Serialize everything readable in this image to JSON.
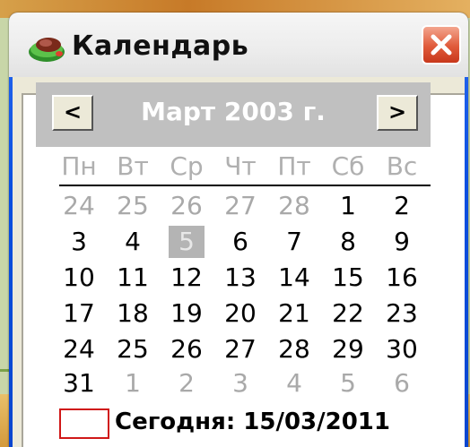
{
  "window": {
    "title": "Календарь"
  },
  "calendar": {
    "month_label": "Март 2003 г.",
    "prev_label": "<",
    "next_label": ">",
    "weekdays": [
      "Пн",
      "Вт",
      "Ср",
      "Чт",
      "Пт",
      "Сб",
      "Вс"
    ],
    "weeks": [
      [
        {
          "d": "24",
          "other": true
        },
        {
          "d": "25",
          "other": true
        },
        {
          "d": "26",
          "other": true
        },
        {
          "d": "27",
          "other": true
        },
        {
          "d": "28",
          "other": true
        },
        {
          "d": "1"
        },
        {
          "d": "2"
        }
      ],
      [
        {
          "d": "3"
        },
        {
          "d": "4"
        },
        {
          "d": "5",
          "selected": true
        },
        {
          "d": "6"
        },
        {
          "d": "7"
        },
        {
          "d": "8"
        },
        {
          "d": "9"
        }
      ],
      [
        {
          "d": "10"
        },
        {
          "d": "11"
        },
        {
          "d": "12"
        },
        {
          "d": "13"
        },
        {
          "d": "14"
        },
        {
          "d": "15"
        },
        {
          "d": "16"
        }
      ],
      [
        {
          "d": "17"
        },
        {
          "d": "18"
        },
        {
          "d": "19"
        },
        {
          "d": "20"
        },
        {
          "d": "21"
        },
        {
          "d": "22"
        },
        {
          "d": "23"
        }
      ],
      [
        {
          "d": "24"
        },
        {
          "d": "25"
        },
        {
          "d": "26"
        },
        {
          "d": "27"
        },
        {
          "d": "28"
        },
        {
          "d": "29"
        },
        {
          "d": "30"
        }
      ],
      [
        {
          "d": "31"
        },
        {
          "d": "1",
          "other": true
        },
        {
          "d": "2",
          "other": true
        },
        {
          "d": "3",
          "other": true
        },
        {
          "d": "4",
          "other": true
        },
        {
          "d": "5",
          "other": true
        },
        {
          "d": "6",
          "other": true
        }
      ]
    ],
    "today_label": "Сегодня: 15/03/2011"
  },
  "icons": {
    "app": "calendar-app-icon",
    "close": "close-icon"
  },
  "colors": {
    "titlebar_blue": "#0b4fe0",
    "today_marker": "#d01818",
    "selected_day": "#b4b4b4"
  }
}
